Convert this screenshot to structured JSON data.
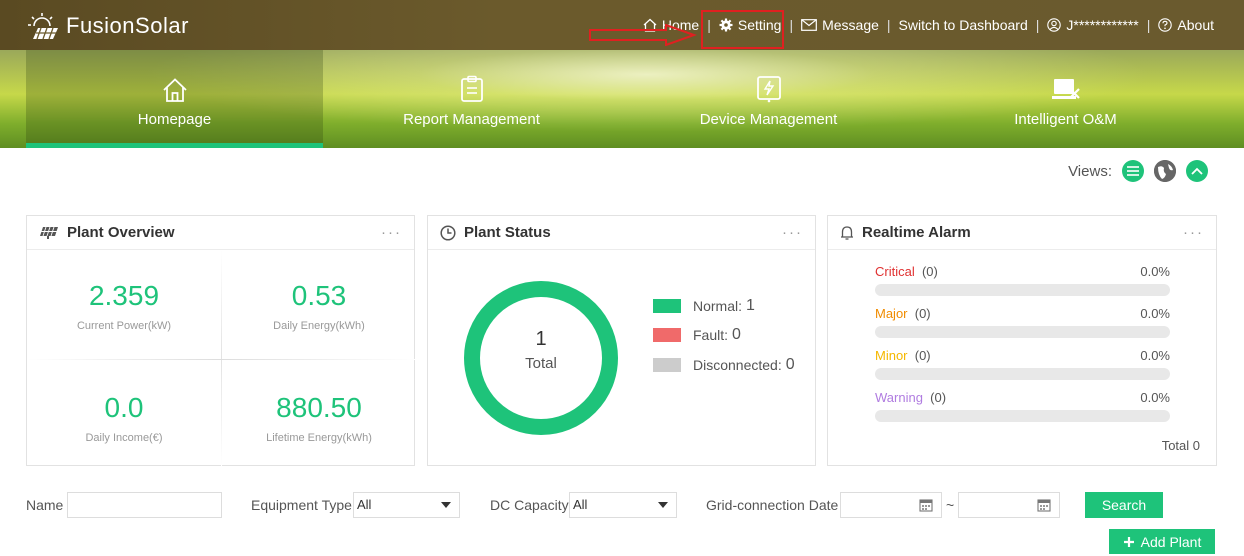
{
  "app": {
    "logo_text": "FusionSolar"
  },
  "topnav": {
    "home": "Home",
    "setting": "Setting",
    "message": "Message",
    "switch_dashboard": "Switch to Dashboard",
    "user": "J************",
    "about": "About"
  },
  "nav": [
    {
      "label": "Homepage"
    },
    {
      "label": "Report Management"
    },
    {
      "label": "Device Management"
    },
    {
      "label": "Intelligent O&M"
    }
  ],
  "views": {
    "label": "Views:"
  },
  "overview": {
    "title": "Plant Overview",
    "current_power": {
      "value": "2.359",
      "label": "Current Power(kW)"
    },
    "daily_energy": {
      "value": "0.53",
      "label": "Daily Energy(kWh)"
    },
    "daily_income": {
      "value": "0.0",
      "label": "Daily Income(€)"
    },
    "lifetime_energy": {
      "value": "880.50",
      "label": "Lifetime Energy(kWh)"
    }
  },
  "status": {
    "title": "Plant Status",
    "total_value": "1",
    "total_label": "Total",
    "normal_label": "Normal:",
    "normal_value": "1",
    "fault_label": "Fault:",
    "fault_value": "0",
    "disconnected_label": "Disconnected:",
    "disconnected_value": "0",
    "colors": {
      "normal": "#1ec37a",
      "fault": "#f06a6a",
      "disconnected": "#cccccc"
    }
  },
  "alarm": {
    "title": "Realtime Alarm",
    "items": [
      {
        "label": "Critical",
        "count": "(0)",
        "pct": "0.0%",
        "color": "#e03131"
      },
      {
        "label": "Major",
        "count": "(0)",
        "pct": "0.0%",
        "color": "#f08c00"
      },
      {
        "label": "Minor",
        "count": "(0)",
        "pct": "0.0%",
        "color": "#f5b800"
      },
      {
        "label": "Warning",
        "count": "(0)",
        "pct": "0.0%",
        "color": "#b07ce0"
      }
    ],
    "total": "Total 0"
  },
  "filters": {
    "name_label": "Name",
    "equipment_label": "Equipment Type",
    "equipment_value": "All",
    "dc_label": "DC Capacity",
    "dc_value": "All",
    "grid_label": "Grid-connection Date",
    "tilde": "~",
    "search": "Search",
    "add_plant": "Add Plant"
  },
  "accent": "#1ec37a"
}
